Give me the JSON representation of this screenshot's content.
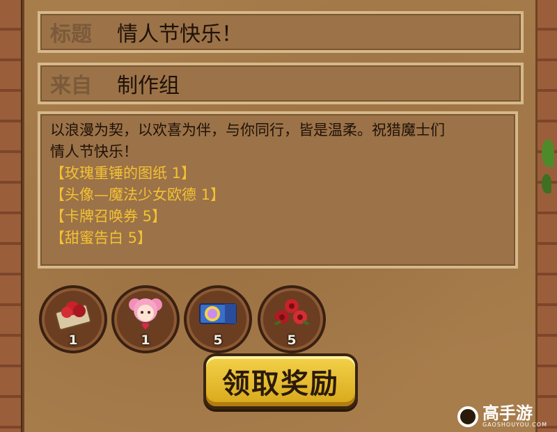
{
  "mail": {
    "title_label": "标题",
    "title_value": "情人节快乐！",
    "from_label": "来自",
    "from_value": "制作组",
    "body_line1": "以浪漫为契，以欢喜为伴，与你同行，皆是温柔。祝猎魔士们",
    "body_line2": "情人节快乐！",
    "items": [
      "【玫瑰重锤的图纸 1】",
      "【头像—魔法少女欧德 1】",
      "【卡牌召唤券 5】",
      "【甜蜜告白 5】"
    ]
  },
  "rewards": [
    {
      "icon": "rose-hammer-blueprint-icon",
      "count": "1"
    },
    {
      "icon": "magical-girl-avatar-icon",
      "count": "1"
    },
    {
      "icon": "summon-ticket-icon",
      "count": "5"
    },
    {
      "icon": "roses-icon",
      "count": "5"
    }
  ],
  "claim_button": "领取奖励",
  "watermark": {
    "name": "高手游",
    "url": "GAOSHOUYOU.COM"
  }
}
